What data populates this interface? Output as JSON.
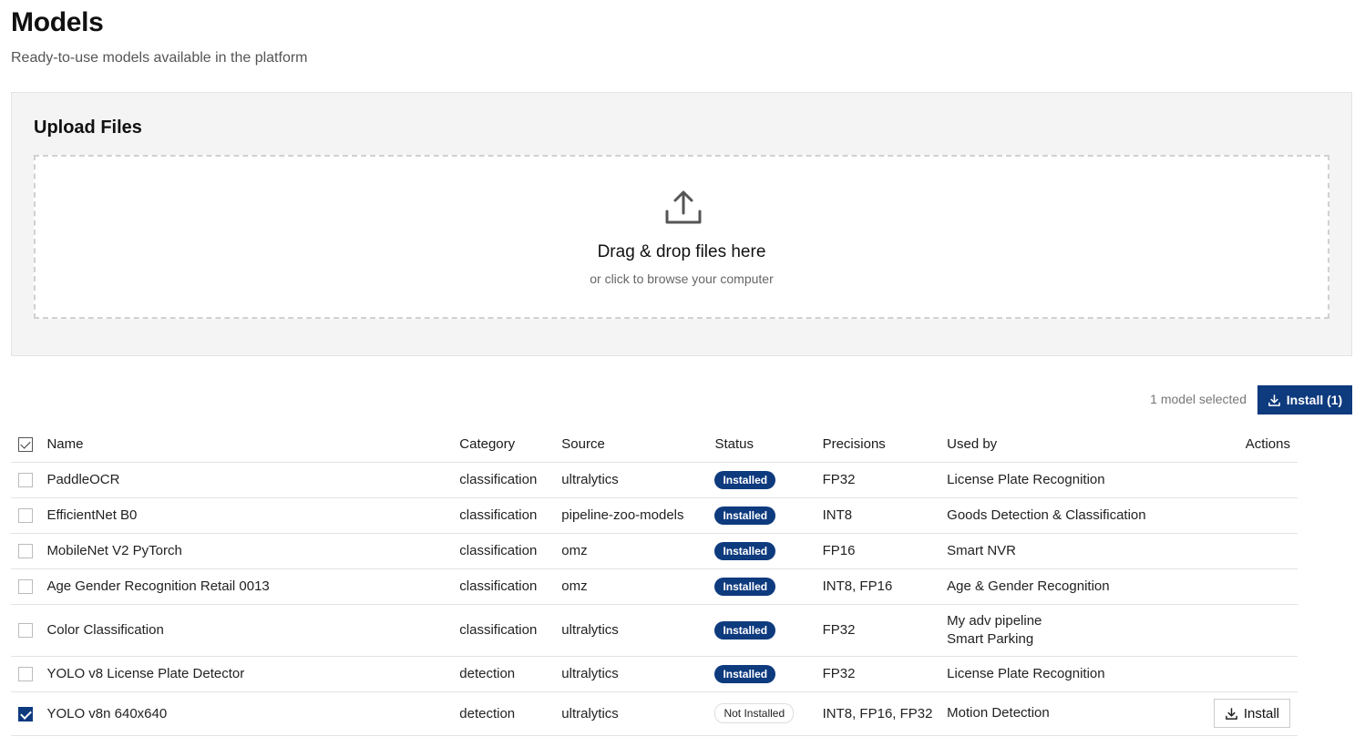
{
  "header": {
    "title": "Models",
    "subtitle": "Ready-to-use models available in the platform"
  },
  "upload": {
    "title": "Upload Files",
    "drop_text": "Drag & drop files here",
    "browse_text": "or click to browse your computer"
  },
  "selection": {
    "info": "1 model selected",
    "install_label": "Install (1)"
  },
  "table": {
    "columns": {
      "name": "Name",
      "category": "Category",
      "source": "Source",
      "status": "Status",
      "precisions": "Precisions",
      "used_by": "Used by",
      "actions": "Actions"
    },
    "rows": [
      {
        "name": "PaddleOCR",
        "category": "classification",
        "source": "ultralytics",
        "status": "Installed",
        "precisions": "FP32",
        "used_by": [
          "License Plate Recognition"
        ],
        "checked": false
      },
      {
        "name": "EfficientNet B0",
        "category": "classification",
        "source": "pipeline-zoo-models",
        "status": "Installed",
        "precisions": "INT8",
        "used_by": [
          "Goods Detection & Classification"
        ],
        "checked": false
      },
      {
        "name": "MobileNet V2 PyTorch",
        "category": "classification",
        "source": "omz",
        "status": "Installed",
        "precisions": "FP16",
        "used_by": [
          "Smart NVR"
        ],
        "checked": false
      },
      {
        "name": "Age Gender Recognition Retail 0013",
        "category": "classification",
        "source": "omz",
        "status": "Installed",
        "precisions": "INT8, FP16",
        "used_by": [
          "Age & Gender Recognition"
        ],
        "checked": false
      },
      {
        "name": "Color Classification",
        "category": "classification",
        "source": "ultralytics",
        "status": "Installed",
        "precisions": "FP32",
        "used_by": [
          "My adv pipeline",
          "Smart Parking"
        ],
        "checked": false
      },
      {
        "name": "YOLO v8 License Plate Detector",
        "category": "detection",
        "source": "ultralytics",
        "status": "Installed",
        "precisions": "FP32",
        "used_by": [
          "License Plate Recognition"
        ],
        "checked": false
      },
      {
        "name": "YOLO v8n 640x640",
        "category": "detection",
        "source": "ultralytics",
        "status": "Not Installed",
        "precisions": "INT8, FP16, FP32",
        "used_by": [
          "Motion Detection"
        ],
        "checked": true,
        "action_label": "Install"
      }
    ]
  },
  "colors": {
    "accent": "#0e3a7e",
    "panel_bg": "#f3f4f3"
  },
  "icons": {
    "dropzone": "upload-icon",
    "install": "download-icon"
  }
}
